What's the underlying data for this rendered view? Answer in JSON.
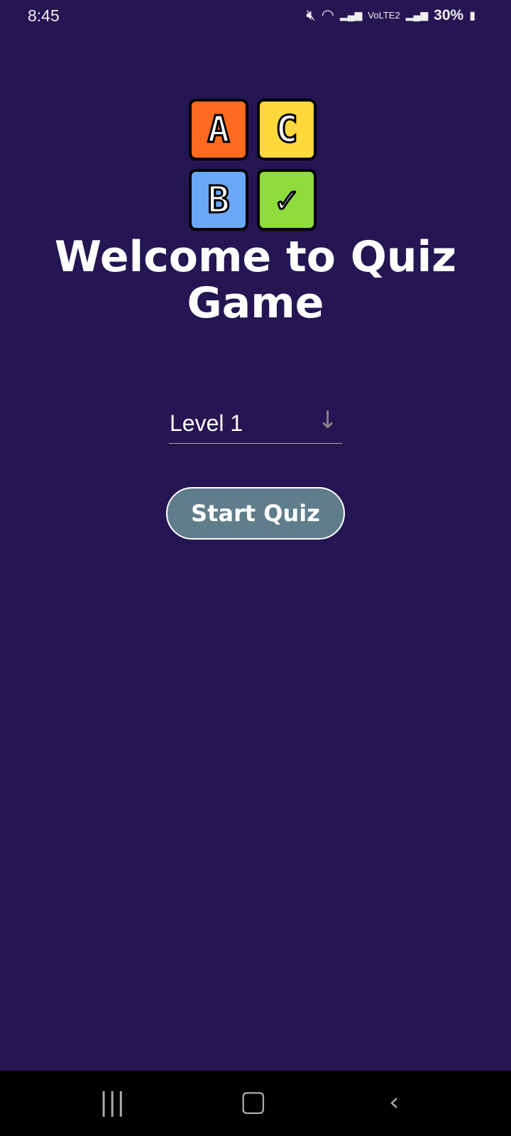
{
  "status_bar": {
    "time": "8:45",
    "network": "VoLTE2",
    "battery": "30%"
  },
  "logo": {
    "tiles": [
      "A",
      "C",
      "B",
      "✓"
    ],
    "colors": [
      "#ff6a1f",
      "#ffd83c",
      "#6aa9f8",
      "#8fdd3c"
    ]
  },
  "title": "Welcome to Quiz Game",
  "level_select": {
    "value": "Level 1"
  },
  "start_button": "Start Quiz",
  "colors": {
    "background": "#241652",
    "button": "#607d8b"
  }
}
